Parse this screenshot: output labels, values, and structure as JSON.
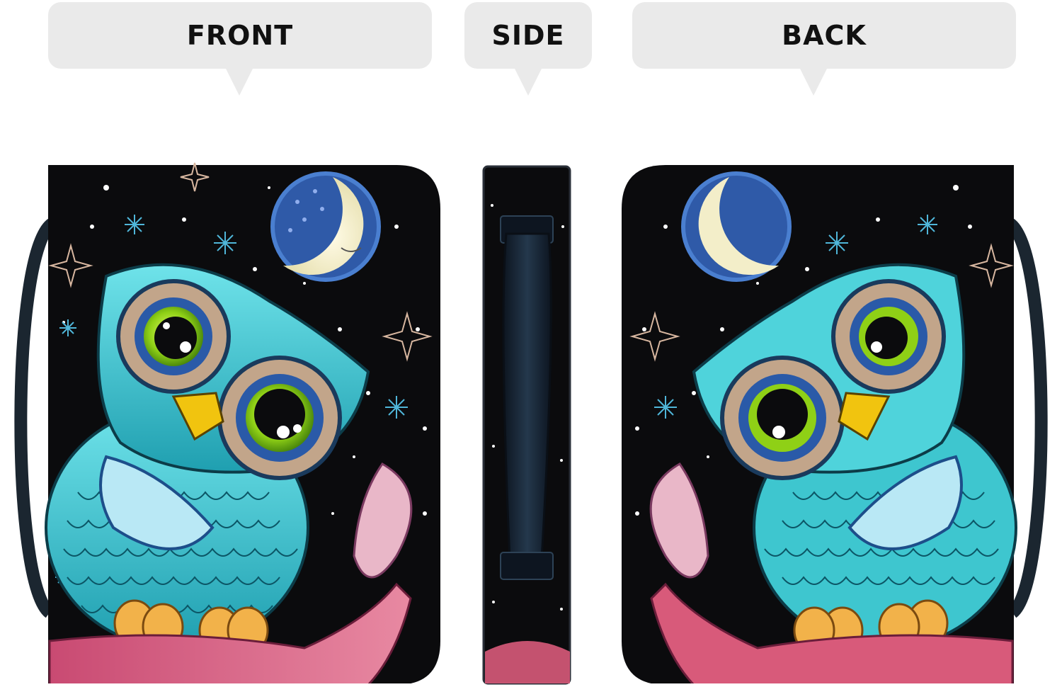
{
  "callouts": {
    "front": "FRONT",
    "side": "SIDE",
    "back": "BACK"
  },
  "colors": {
    "cover_background": "#0b0b0d",
    "owl_teal": "#3ec6cf",
    "owl_eye_green": "#8fd016",
    "moon_blue": "#3f66b8",
    "moon_cream": "#f3eec9",
    "branch_pink": "#d85a7a",
    "beak_yellow": "#f1c40f",
    "callout_gray": "#eaeaea"
  },
  "icons": [
    "owl",
    "crescent-moon",
    "snowflake",
    "star",
    "handle-strap"
  ]
}
